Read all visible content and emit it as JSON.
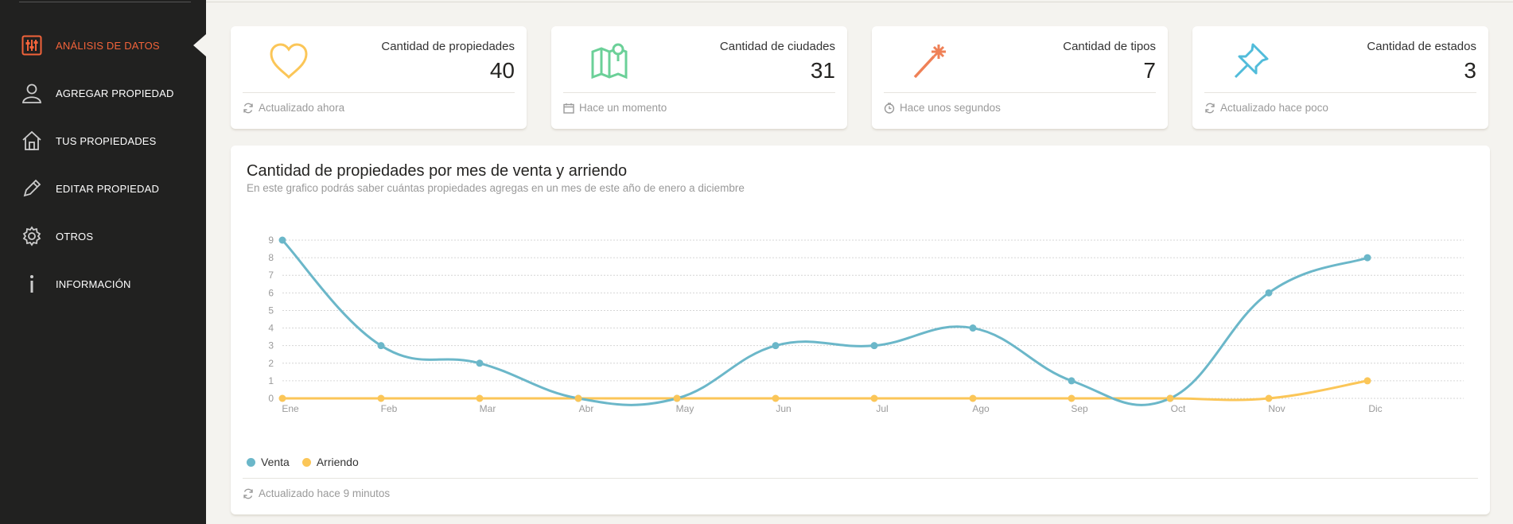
{
  "sidebar": {
    "items": [
      {
        "label": "ANÁLISIS DE DATOS",
        "icon": "sliders-icon",
        "active": true
      },
      {
        "label": "AGREGAR PROPIEDAD",
        "icon": "user-icon"
      },
      {
        "label": "TUS PROPIEDADES",
        "icon": "home-icon"
      },
      {
        "label": "EDITAR PROPIEDAD",
        "icon": "pencil-icon"
      },
      {
        "label": "OTROS",
        "icon": "gear-icon"
      },
      {
        "label": "INFORMACIÓN",
        "icon": "info-icon"
      }
    ],
    "active_color": "#f2633a"
  },
  "stats": [
    {
      "title": "Cantidad de propiedades",
      "value": "40",
      "footer": "Actualizado ahora",
      "icon": "heart-icon",
      "color": "#fbc658",
      "footer_icon": "refresh-icon"
    },
    {
      "title": "Cantidad de ciudades",
      "value": "31",
      "footer": "Hace un momento",
      "icon": "map-icon",
      "color": "#6bd098",
      "footer_icon": "calendar-icon"
    },
    {
      "title": "Cantidad de tipos",
      "value": "7",
      "footer": "Hace unos segundos",
      "icon": "magic-wand-icon",
      "color": "#ef8157",
      "footer_icon": "clock-icon"
    },
    {
      "title": "Cantidad de estados",
      "value": "3",
      "footer": "Actualizado hace poco",
      "icon": "pushpin-icon",
      "color": "#51bcda",
      "footer_icon": "refresh-icon"
    }
  ],
  "chart": {
    "title": "Cantidad de propiedades por mes de venta y arriendo",
    "subtitle": "En este grafico podrás saber cuántas propiedades agregas en un mes de este año de enero a diciembre",
    "footer": "Actualizado hace 9 minutos"
  },
  "chart_data": {
    "type": "line",
    "categories": [
      "Ene",
      "Feb",
      "Mar",
      "Abr",
      "May",
      "Jun",
      "Jul",
      "Ago",
      "Sep",
      "Oct",
      "Nov",
      "Dic"
    ],
    "series": [
      {
        "name": "Venta",
        "values": [
          9,
          3,
          2,
          0,
          0,
          3,
          3,
          4,
          1,
          0,
          6,
          8
        ],
        "color": "#6bb7c9"
      },
      {
        "name": "Arriendo",
        "values": [
          0,
          0,
          0,
          0,
          0,
          0,
          0,
          0,
          0,
          0,
          0,
          1
        ],
        "color": "#fbc658"
      }
    ],
    "ylim": [
      0,
      9
    ],
    "yticks": [
      0,
      1,
      2,
      3,
      4,
      5,
      6,
      7,
      8,
      9
    ],
    "grid": true,
    "legend": "bottom-left"
  }
}
